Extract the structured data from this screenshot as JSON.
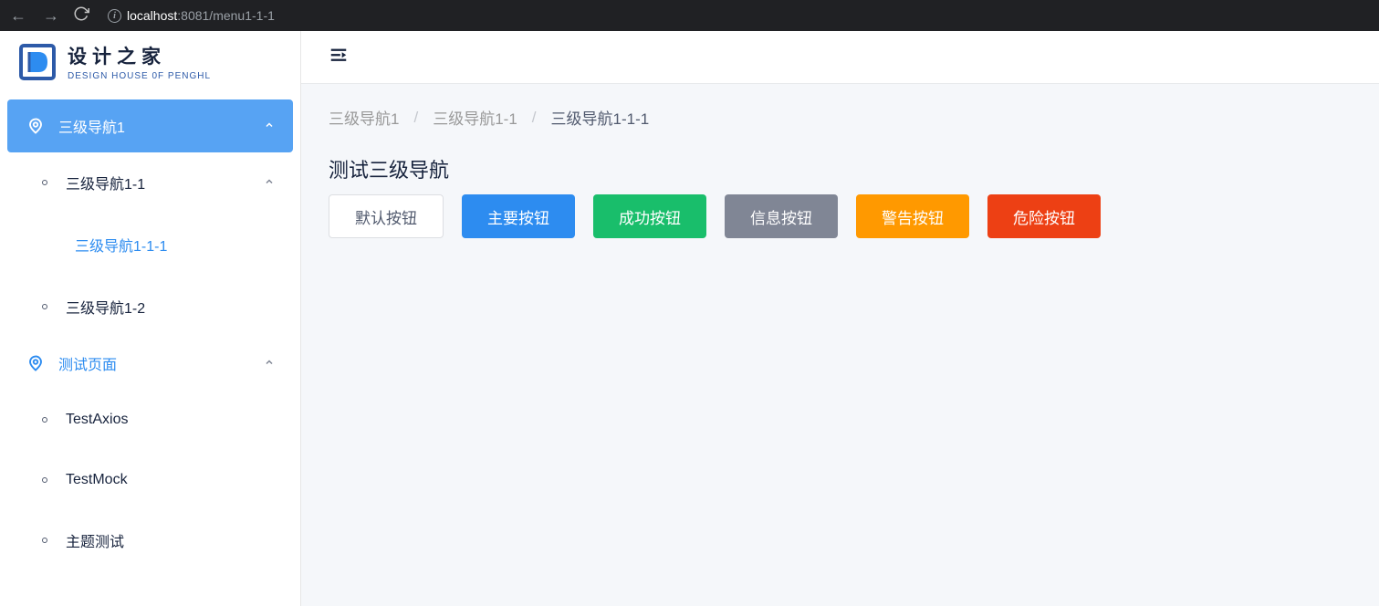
{
  "browser": {
    "url_prefix": "localhost",
    "url_suffix": ":8081/menu1-1-1"
  },
  "logo": {
    "title": "设计之家",
    "subtitle": "DESIGN HOUSE 0F PENGHL"
  },
  "sidebar": {
    "groups": [
      {
        "label": "三级导航1",
        "icon": "location-pin-icon",
        "active": true,
        "items": [
          {
            "label": "三级导航1-1",
            "expanded": true,
            "children": [
              {
                "label": "三级导航1-1-1",
                "active": true
              }
            ]
          },
          {
            "label": "三级导航1-2"
          }
        ]
      },
      {
        "label": "测试页面",
        "icon": "location-pin-icon",
        "highlighted": true,
        "items": [
          {
            "label": "TestAxios"
          },
          {
            "label": "TestMock"
          },
          {
            "label": "主题测试"
          }
        ]
      }
    ]
  },
  "breadcrumb": {
    "items": [
      "三级导航1",
      "三级导航1-1",
      "三级导航1-1-1"
    ],
    "separator": "/"
  },
  "content": {
    "title": "测试三级导航",
    "buttons": [
      {
        "label": "默认按钮",
        "type": "default"
      },
      {
        "label": "主要按钮",
        "type": "primary"
      },
      {
        "label": "成功按钮",
        "type": "success"
      },
      {
        "label": "信息按钮",
        "type": "info"
      },
      {
        "label": "警告按钮",
        "type": "warning"
      },
      {
        "label": "危险按钮",
        "type": "error"
      }
    ]
  }
}
